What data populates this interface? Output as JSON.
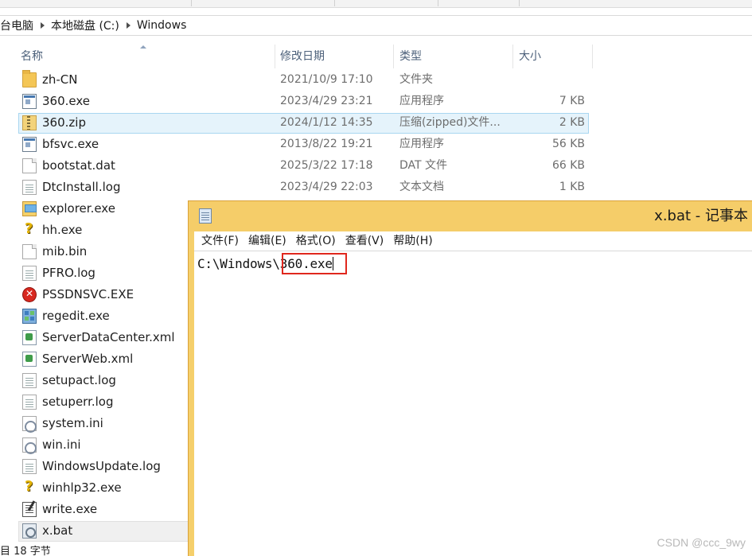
{
  "breadcrumb": {
    "items": [
      "台电脑",
      "本地磁盘 (C:)",
      "Windows"
    ]
  },
  "columns": {
    "name": "名称",
    "date": "修改日期",
    "type": "类型",
    "size": "大小"
  },
  "files": [
    {
      "name": "zh-CN",
      "date": "2021/10/9 17:10",
      "type": "文件夹",
      "size": "",
      "icon": "folder-icon"
    },
    {
      "name": "360.exe",
      "date": "2023/4/29 23:21",
      "type": "应用程序",
      "size": "7 KB",
      "icon": "exe-icon"
    },
    {
      "name": "360.zip",
      "date": "2024/1/12 14:35",
      "type": "压缩(zipped)文件...",
      "size": "2 KB",
      "icon": "zip-icon"
    },
    {
      "name": "bfsvc.exe",
      "date": "2013/8/22 19:21",
      "type": "应用程序",
      "size": "56 KB",
      "icon": "exe-icon"
    },
    {
      "name": "bootstat.dat",
      "date": "2025/3/22 17:18",
      "type": "DAT 文件",
      "size": "66 KB",
      "icon": "file-icon"
    },
    {
      "name": "DtcInstall.log",
      "date": "2023/4/29 22:03",
      "type": "文本文档",
      "size": "1 KB",
      "icon": "text-file-icon"
    },
    {
      "name": "explorer.exe",
      "date": "",
      "type": "",
      "size": "",
      "icon": "explorer-icon"
    },
    {
      "name": "hh.exe",
      "date": "",
      "type": "",
      "size": "",
      "icon": "help-icon"
    },
    {
      "name": "mib.bin",
      "date": "",
      "type": "",
      "size": "",
      "icon": "file-icon"
    },
    {
      "name": "PFRO.log",
      "date": "",
      "type": "",
      "size": "",
      "icon": "text-file-icon"
    },
    {
      "name": "PSSDNSVC.EXE",
      "date": "",
      "type": "",
      "size": "",
      "icon": "error-icon"
    },
    {
      "name": "regedit.exe",
      "date": "",
      "type": "",
      "size": "",
      "icon": "regedit-icon"
    },
    {
      "name": "ServerDataCenter.xml",
      "date": "",
      "type": "",
      "size": "",
      "icon": "xml-icon"
    },
    {
      "name": "ServerWeb.xml",
      "date": "",
      "type": "",
      "size": "",
      "icon": "xml-icon"
    },
    {
      "name": "setupact.log",
      "date": "",
      "type": "",
      "size": "",
      "icon": "text-file-icon"
    },
    {
      "name": "setuperr.log",
      "date": "",
      "type": "",
      "size": "",
      "icon": "text-file-icon"
    },
    {
      "name": "system.ini",
      "date": "",
      "type": "",
      "size": "",
      "icon": "ini-icon"
    },
    {
      "name": "win.ini",
      "date": "",
      "type": "",
      "size": "",
      "icon": "ini-icon"
    },
    {
      "name": "WindowsUpdate.log",
      "date": "",
      "type": "",
      "size": "",
      "icon": "text-file-icon"
    },
    {
      "name": "winhlp32.exe",
      "date": "",
      "type": "",
      "size": "",
      "icon": "help-icon"
    },
    {
      "name": "write.exe",
      "date": "",
      "type": "",
      "size": "",
      "icon": "write-icon"
    },
    {
      "name": "x.bat",
      "date": "",
      "type": "",
      "size": "",
      "icon": "bat-icon"
    }
  ],
  "selected_file": "360.zip",
  "status": {
    "text": "目 18 字节"
  },
  "notepad": {
    "title": "x.bat - 记事本",
    "menus": [
      "文件(F)",
      "编辑(E)",
      "格式(O)",
      "查看(V)",
      "帮助(H)"
    ],
    "content_prefix": "C:\\Windows\\",
    "content_highlight": "360.exe",
    "highlight_color": "#e0271d"
  },
  "watermark": "CSDN @ccc_9wy"
}
